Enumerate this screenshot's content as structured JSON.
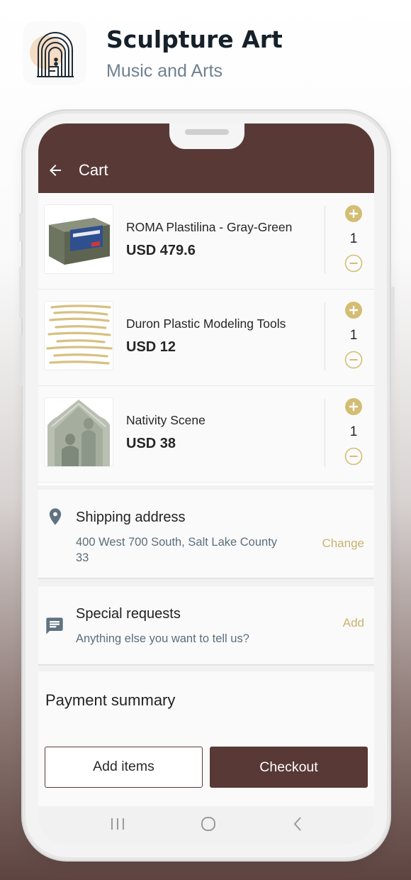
{
  "app": {
    "name": "Sculpture Art",
    "category": "Music and Arts"
  },
  "screen": {
    "title": "Cart",
    "accent_color": "#583936",
    "qty_icon_color": "#d4bd73"
  },
  "cart": {
    "items": [
      {
        "name": "ROMA Plastilina - Gray-Green",
        "price": "USD 479.6",
        "quantity": "1",
        "thumb": "clay-block-image"
      },
      {
        "name": " Duron Plastic Modeling Tools",
        "price": "USD 12",
        "quantity": "1",
        "thumb": "modeling-tools-image"
      },
      {
        "name": "Nativity Scene",
        "price": "USD 38",
        "quantity": "1",
        "thumb": "nativity-relief-image"
      }
    ]
  },
  "shipping": {
    "title": "Shipping address",
    "address_line1": "400 West 700 South, Salt Lake County",
    "address_line2": "33",
    "action": "Change",
    "icon": "location-pin-icon"
  },
  "requests": {
    "title": "Special requests",
    "placeholder": "Anything else you want to tell us?",
    "action": "Add",
    "icon": "message-icon"
  },
  "payment": {
    "title": "Payment summary",
    "add_items_label": "Add items",
    "checkout_label": "Checkout"
  },
  "navbar": {
    "icons": [
      "recent-apps-icon",
      "home-icon",
      "back-nav-icon"
    ]
  }
}
